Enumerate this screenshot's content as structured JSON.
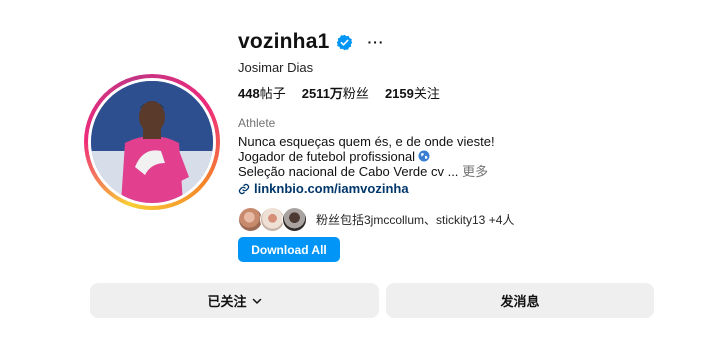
{
  "profile": {
    "username": "vozinha1",
    "full_name": "Josimar Dias",
    "verified": true,
    "stats": {
      "posts_count": "448",
      "posts_label": "帖子",
      "followers_count": "2511万",
      "followers_label": "粉丝",
      "following_count": "2159",
      "following_label": "关注"
    },
    "category": "Athlete",
    "bio_lines": [
      "Nunca esqueças quem és, e de onde vieste!",
      "Jogador de futebol profissional",
      "Seleção nacional de Cabo Verde cv ..."
    ],
    "bio_more": "更多",
    "link": "linknbio.com/iamvozinha",
    "followed_by_text": "粉丝包括3jmccollum、stickity13 +4人"
  },
  "buttons": {
    "download_all": "Download All",
    "following": "已关注",
    "message": "发消息"
  },
  "colors": {
    "accent": "#0095f6",
    "link": "#00376b",
    "verified": "#0095f6",
    "button_bg": "#efefef",
    "muted": "#737373"
  },
  "icons": [
    "verified-badge-icon",
    "more-options-icon",
    "globe-icon",
    "link-icon",
    "chevron-down-icon"
  ]
}
